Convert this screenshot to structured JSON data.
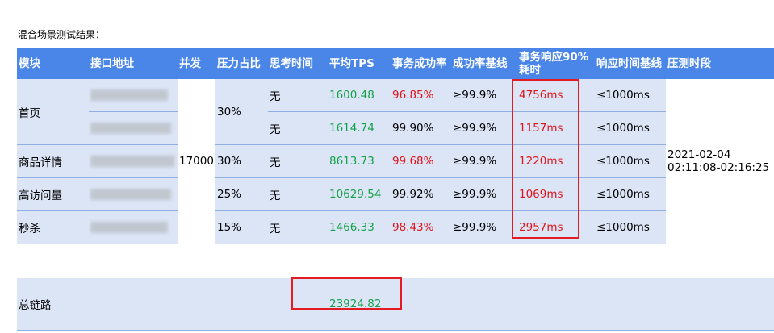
{
  "caption": "混合场景测试结果：",
  "headers": [
    "模块",
    "接口地址",
    "并发",
    "压力占比",
    "思考时间",
    "平均TPS",
    "事务成功率",
    "成功率基线",
    "事务响应90%耗时",
    "响应时间基线",
    "压测时段"
  ],
  "header_90_line1": "事务响应90%",
  "header_90_line2": "耗时",
  "concurrency": "17000",
  "period_line1": "2021-02-04",
  "period_line2": "02:11:08-02:16:25",
  "rows": [
    {
      "module": "首页",
      "ratio": "30%",
      "think": "无",
      "tps": "1600.48",
      "success": "96.85%",
      "baseline": "≥99.9%",
      "rt": "4756ms",
      "rt_baseline": "≤1000ms"
    },
    {
      "module": "",
      "ratio": "",
      "think": "无",
      "tps": "1614.74",
      "success": "99.90%",
      "baseline": "≥99.9%",
      "rt": "1157ms",
      "rt_baseline": "≤1000ms"
    },
    {
      "module": "商品详情",
      "ratio": "30%",
      "think": "无",
      "tps": "8613.73",
      "success": "99.68%",
      "baseline": "≥99.9%",
      "rt": "1220ms",
      "rt_baseline": "≤1000ms"
    },
    {
      "module": "高访问量",
      "ratio": "25%",
      "think": "无",
      "tps": "10629.54",
      "success": "99.92%",
      "baseline": "≥99.9%",
      "rt": "1069ms",
      "rt_baseline": "≤1000ms"
    },
    {
      "module": "秒杀",
      "ratio": "15%",
      "think": "无",
      "tps": "1466.33",
      "success": "98.43%",
      "baseline": "≥99.9%",
      "rt": "2957ms",
      "rt_baseline": "≤1000ms"
    }
  ],
  "total": {
    "label": "总链路",
    "tps": "23924.82"
  }
}
